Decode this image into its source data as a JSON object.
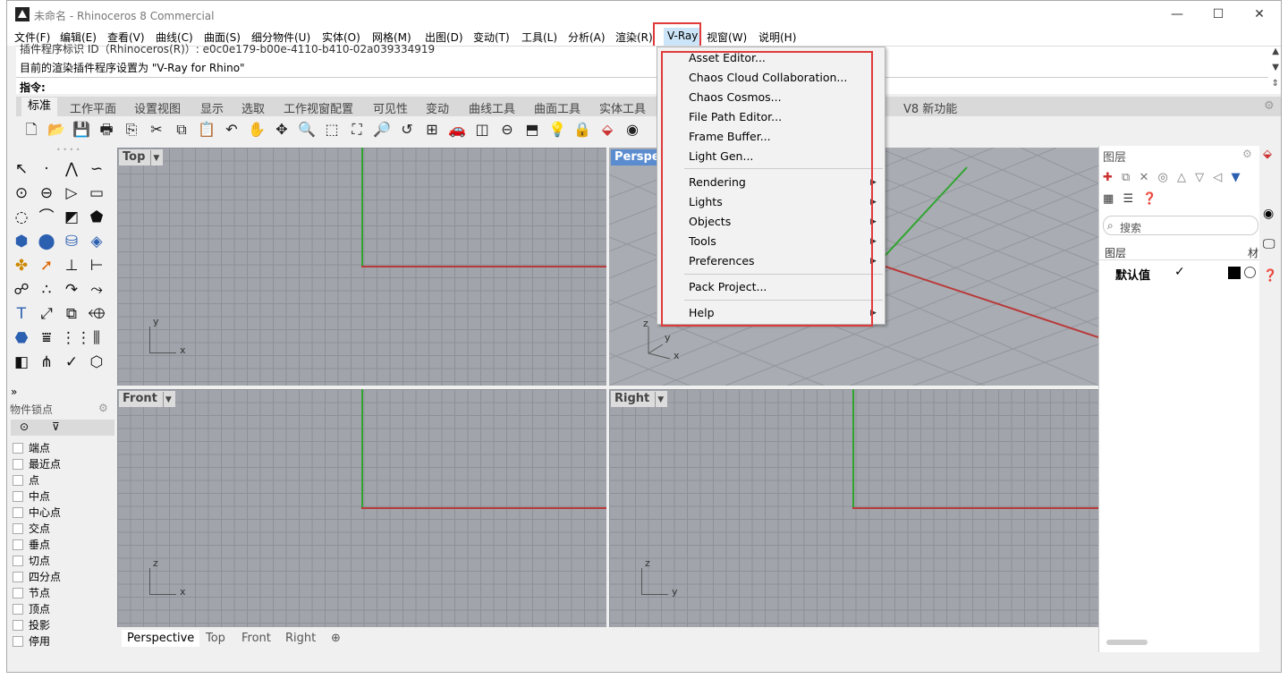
{
  "window": {
    "title": "未命名 - Rhinoceros 8 Commercial"
  },
  "menubar": [
    "文件(F)",
    "编辑(E)",
    "查看(V)",
    "曲线(C)",
    "曲面(S)",
    "细分物件(U)",
    "实体(O)",
    "网格(M)",
    "出图(D)",
    "变动(T)",
    "工具(L)",
    "分析(A)",
    "渲染(R)",
    "V-Ray",
    "视窗(W)",
    "说明(H)"
  ],
  "command": {
    "history_partial": "插件程序标识 ID（Rhinoceros(R)）: e0c0e179-b00e-4110-b410-02a039334919",
    "history_last": "目前的渲染插件程序设置为 \"V-Ray for Rhino\"",
    "prompt": "指令:"
  },
  "toolbar_tabs": [
    "标准",
    "工作平面",
    "设置视图",
    "显示",
    "选取",
    "工作视窗配置",
    "可见性",
    "变动",
    "曲线工具",
    "曲面工具",
    "实体工具",
    "V8 新功能"
  ],
  "viewports": {
    "top": {
      "label": "Top",
      "ax1": "y",
      "ax2": "x"
    },
    "perspective": {
      "label": "Perspe",
      "ax1": "z",
      "ax2": "y",
      "ax3": "x"
    },
    "front": {
      "label": "Front",
      "ax1": "z",
      "ax2": "x"
    },
    "right": {
      "label": "Right",
      "ax1": "z",
      "ax2": "y"
    }
  },
  "bottom_tabs": [
    "Perspective",
    "Top",
    "Front",
    "Right"
  ],
  "osnap": {
    "title": "物件锁点",
    "items": [
      "端点",
      "最近点",
      "点",
      "中点",
      "中心点",
      "交点",
      "垂点",
      "切点",
      "四分点",
      "节点",
      "顶点",
      "投影",
      "停用"
    ]
  },
  "layers": {
    "title": "图层",
    "search_placeholder": "搜索",
    "col_layer": "图层",
    "col_material": "材",
    "default_layer": "默认值",
    "check": "✓"
  },
  "vray_menu": {
    "items": [
      "Asset Editor...",
      "Chaos Cloud Collaboration...",
      "Chaos Cosmos...",
      "File Path Editor...",
      "Frame Buffer...",
      "Light Gen..."
    ],
    "submenus": [
      "Rendering",
      "Lights",
      "Objects",
      "Tools",
      "Preferences"
    ],
    "pack": "Pack Project...",
    "help": "Help"
  },
  "colors": {
    "highlight_box": "#e03a3a",
    "x_axis": "#b83a3a",
    "y_axis": "#2fa52f"
  }
}
